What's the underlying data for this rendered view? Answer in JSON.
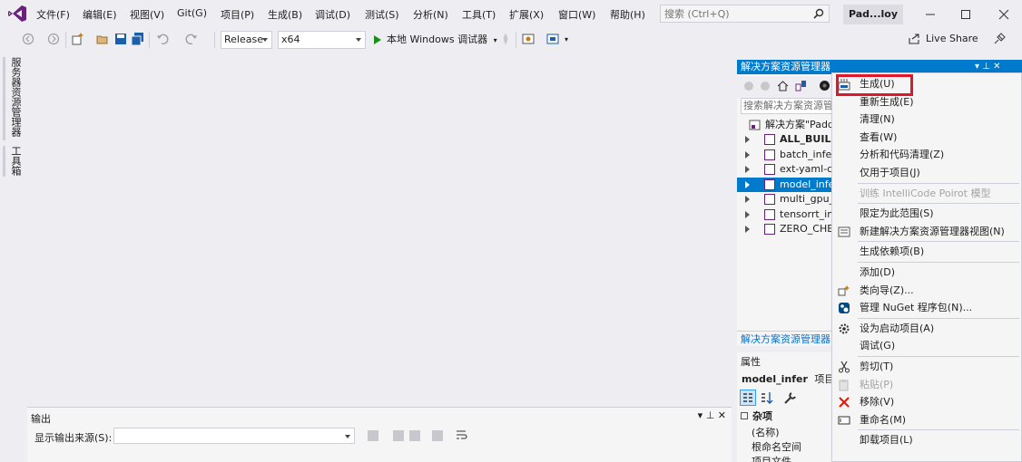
{
  "menubar": {
    "items": [
      "文件(F)",
      "编辑(E)",
      "视图(V)",
      "Git(G)",
      "项目(P)",
      "生成(B)",
      "调试(D)",
      "测试(S)",
      "分析(N)",
      "工具(T)",
      "扩展(X)",
      "窗口(W)",
      "帮助(H)"
    ],
    "search_placeholder": "搜索 (Ctrl+Q)",
    "solution_name": "Pad...loy",
    "window_controls": [
      "minimize-icon",
      "maximize-icon",
      "close-icon"
    ]
  },
  "toolbar": {
    "configuration": "Release",
    "platform": "x64",
    "run_label": "本地 Windows 调试器",
    "live_share_label": "Live Share"
  },
  "left_strip": {
    "tabs": [
      "服务器资源管理器",
      "工具箱"
    ]
  },
  "output": {
    "title": "输出",
    "controls": "▾ ⊥ ✕",
    "source_label": "显示输出来源(S):",
    "source_value": ""
  },
  "solution_explorer": {
    "title": "解决方案资源管理器",
    "header_controls": "▾ ⊥ ✕",
    "search_placeholder": "搜索解决方案资源管理器",
    "solution_label": "解决方案\"Padd",
    "projects": [
      {
        "label": "ALL_BUILD",
        "bold": true,
        "selected": false
      },
      {
        "label": "batch_infer",
        "bold": false,
        "selected": false
      },
      {
        "label": "ext-yaml-cp",
        "bold": false,
        "selected": false
      },
      {
        "label": "model_infe",
        "bold": false,
        "selected": true
      },
      {
        "label": "multi_gpu_",
        "bold": false,
        "selected": false
      },
      {
        "label": "tensorrt_in",
        "bold": false,
        "selected": false
      },
      {
        "label": "ZERO_CHEC",
        "bold": false,
        "selected": false
      }
    ],
    "footer_tab": "解决方案资源管理器"
  },
  "properties": {
    "title": "属性",
    "object_name": "model_infer",
    "object_type": "项目属",
    "category": "杂项",
    "rows": [
      "(名称)",
      "根命名空间",
      "项目文件"
    ]
  },
  "context_menu": {
    "items": [
      {
        "label": "生成(U)",
        "icon": "build-icon",
        "disabled": false,
        "highlighted": true
      },
      {
        "label": "重新生成(E)",
        "icon": "",
        "disabled": false
      },
      {
        "label": "清理(N)",
        "icon": "",
        "disabled": false
      },
      {
        "label": "查看(W)",
        "icon": "",
        "disabled": false
      },
      {
        "label": "分析和代码清理(Z)",
        "icon": "",
        "disabled": false
      },
      {
        "label": "仅用于项目(J)",
        "icon": "",
        "disabled": false
      },
      {
        "sep": true
      },
      {
        "label": "训练 IntelliCode Poirot 模型",
        "icon": "",
        "disabled": true
      },
      {
        "sep": true
      },
      {
        "label": "限定为此范围(S)",
        "icon": "",
        "disabled": false
      },
      {
        "label": "新建解决方案资源管理器视图(N)",
        "icon": "new-view-icon",
        "disabled": false
      },
      {
        "sep": true
      },
      {
        "label": "生成依赖项(B)",
        "icon": "",
        "disabled": false
      },
      {
        "sep": true
      },
      {
        "label": "添加(D)",
        "icon": "",
        "disabled": false
      },
      {
        "label": "类向导(Z)...",
        "icon": "class-wizard-icon",
        "disabled": false
      },
      {
        "label": "管理 NuGet 程序包(N)...",
        "icon": "nuget-icon",
        "disabled": false
      },
      {
        "sep": true
      },
      {
        "label": "设为启动项目(A)",
        "icon": "gear-icon",
        "disabled": false
      },
      {
        "label": "调试(G)",
        "icon": "",
        "disabled": false
      },
      {
        "sep": true
      },
      {
        "label": "剪切(T)",
        "icon": "scissors-icon",
        "disabled": false
      },
      {
        "label": "粘贴(P)",
        "icon": "paste-icon",
        "disabled": true
      },
      {
        "label": "移除(V)",
        "icon": "remove-icon",
        "disabled": false
      },
      {
        "label": "重命名(M)",
        "icon": "rename-icon",
        "disabled": false
      },
      {
        "sep": true
      },
      {
        "label": "卸载项目(L)",
        "icon": "",
        "disabled": false
      }
    ]
  },
  "colors": {
    "accent": "#007acc",
    "highlight_box": "#e0162b",
    "remove": "#e51400"
  }
}
